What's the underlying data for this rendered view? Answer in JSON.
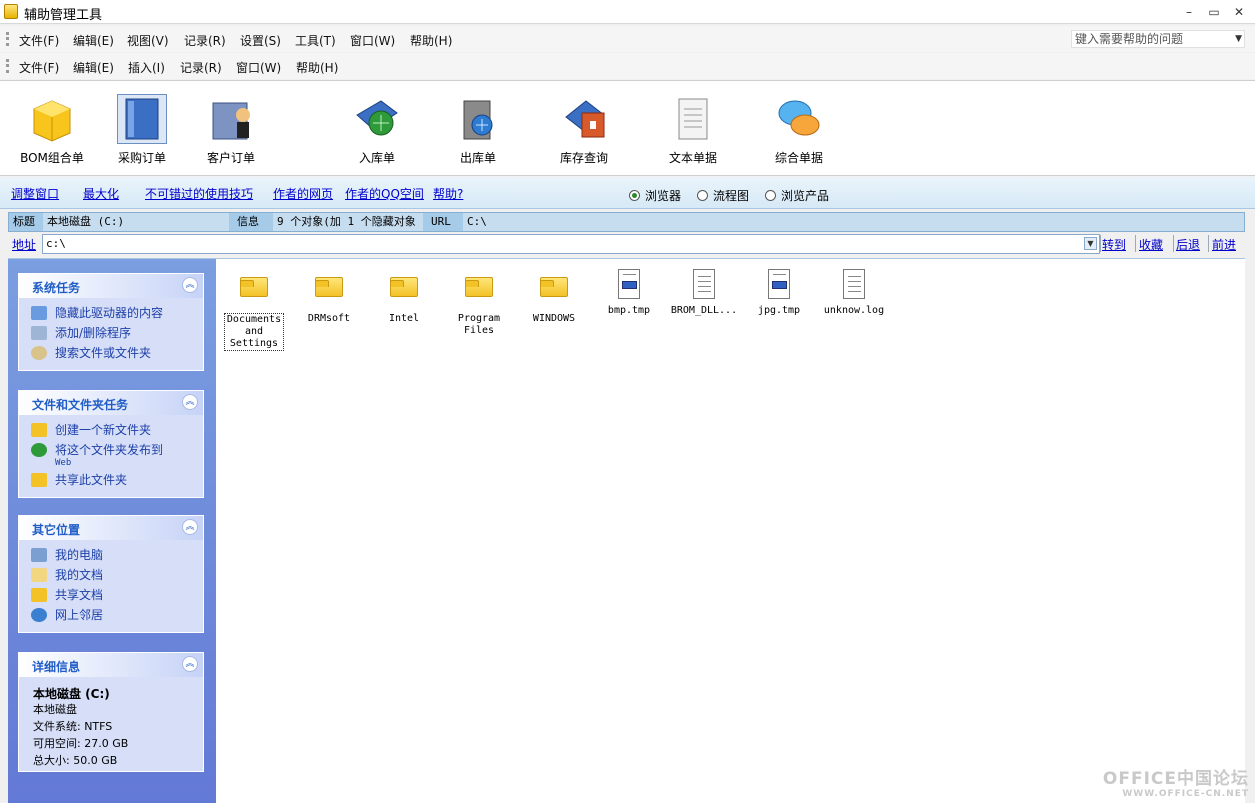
{
  "window": {
    "title": "辅助管理工具",
    "minimize": "–",
    "restore": "▭",
    "close": "✕"
  },
  "menubar1": {
    "items": [
      "文件(F)",
      "编辑(E)",
      "视图(V)",
      "记录(R)",
      "设置(S)",
      "工具(T)",
      "窗口(W)",
      "帮助(H)"
    ],
    "help_placeholder": "键入需要帮助的问题"
  },
  "menubar2": {
    "items": [
      "文件(F)",
      "编辑(E)",
      "插入(I)",
      "记录(R)",
      "窗口(W)",
      "帮助(H)"
    ]
  },
  "toolbar": {
    "buttons": [
      "BOM组合单",
      "采购订单",
      "客户订单",
      "入库单",
      "出库单",
      "库存查询",
      "文本单据",
      "综合单据"
    ],
    "selected": "采购订单"
  },
  "links": {
    "items": [
      "调整窗口",
      "最大化",
      "不可错过的使用技巧",
      "作者的网页",
      "作者的QQ空间",
      "帮助?"
    ],
    "radios": [
      "浏览器",
      "流程图",
      "浏览产品"
    ],
    "selected_radio": "浏览器"
  },
  "info": {
    "title_label": "标题",
    "title_value": "本地磁盘 (C:)",
    "info_label": "信息",
    "info_value": "9 个对象(加 1 个隐藏对象",
    "url_label": "URL",
    "url_value": "C:\\"
  },
  "address": {
    "label": "地址",
    "value": "c:\\",
    "nav": [
      "转到",
      "收藏",
      "后退",
      "前进"
    ]
  },
  "sidebar": {
    "system_tasks": {
      "title": "系统任务",
      "items": [
        "隐藏此驱动器的内容",
        "添加/删除程序",
        "搜索文件或文件夹"
      ]
    },
    "file_tasks": {
      "title": "文件和文件夹任务",
      "items": [
        "创建一个新文件夹",
        "将这个文件夹发布到",
        "Web",
        "共享此文件夹"
      ]
    },
    "other_places": {
      "title": "其它位置",
      "items": [
        "我的电脑",
        "我的文档",
        "共享文档",
        "网上邻居"
      ]
    },
    "details": {
      "title": "详细信息",
      "name": "本地磁盘 (C:)",
      "type": "本地磁盘",
      "fs": "文件系统: NTFS",
      "free": "可用空间: 27.0 GB",
      "total": "总大小: 50.0 GB"
    }
  },
  "files": [
    {
      "name": "Documents\nand\nSettings",
      "kind": "folder"
    },
    {
      "name": "DRMsoft",
      "kind": "folder"
    },
    {
      "name": "Intel",
      "kind": "folder"
    },
    {
      "name": "Program\nFiles",
      "kind": "folder"
    },
    {
      "name": "WINDOWS",
      "kind": "folder"
    },
    {
      "name": "bmp.tmp",
      "kind": "file-image"
    },
    {
      "name": "BROM_DLL...",
      "kind": "file-text"
    },
    {
      "name": "jpg.tmp",
      "kind": "file-image"
    },
    {
      "name": "unknow.log",
      "kind": "file-text"
    }
  ],
  "watermark": {
    "line1": "OFFICE中国论坛",
    "line2": "WWW.OFFICE-CN.NET"
  }
}
